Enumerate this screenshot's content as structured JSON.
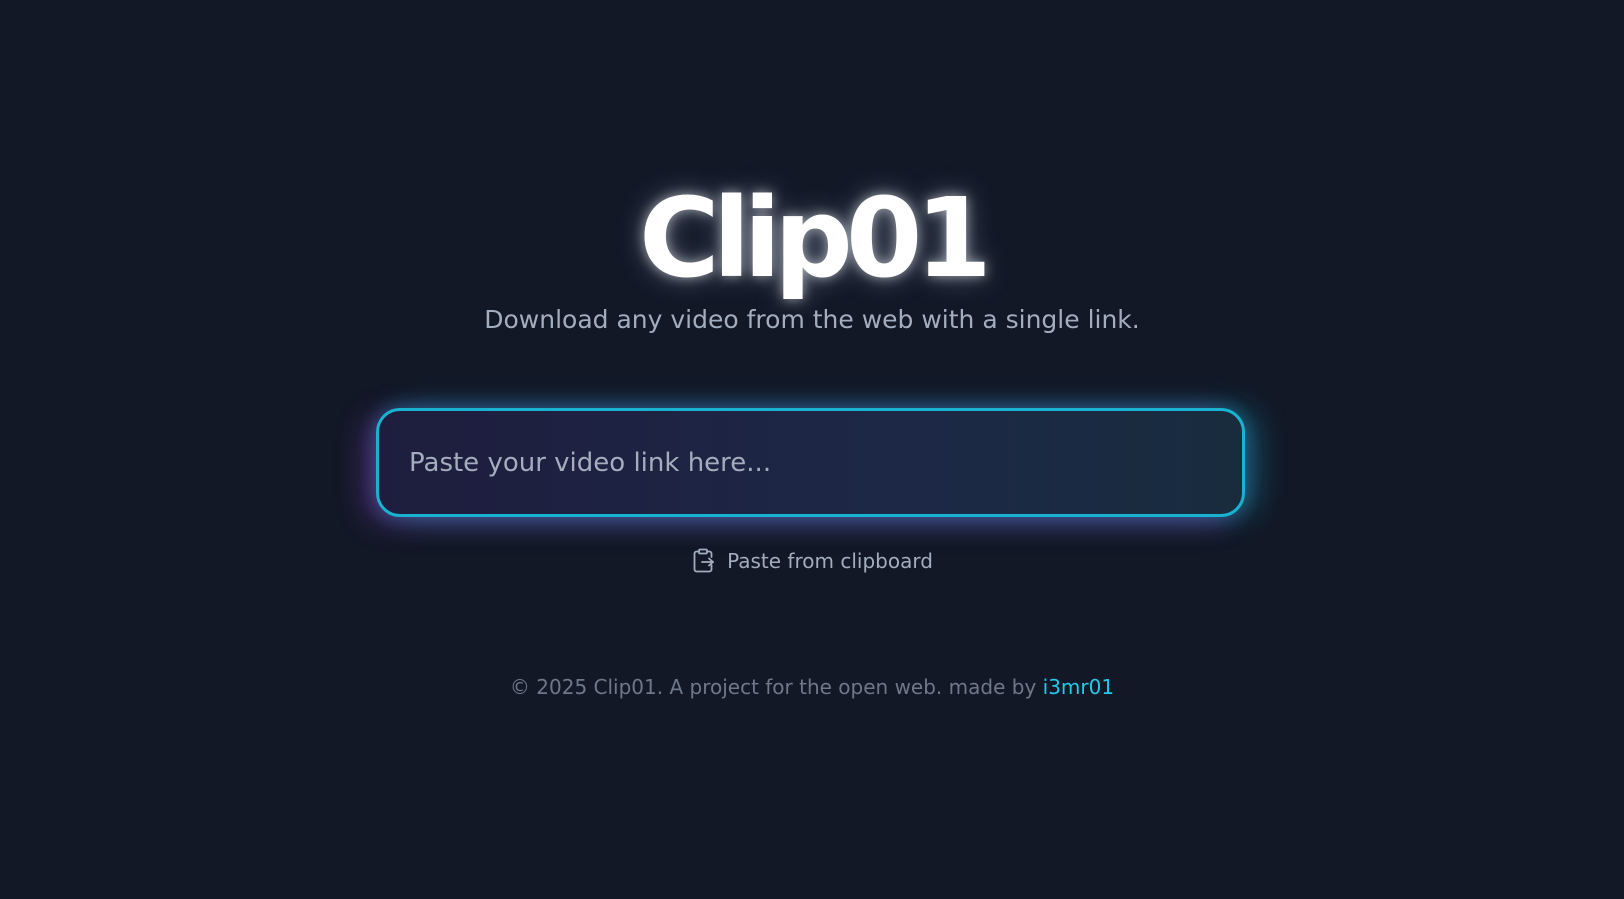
{
  "header": {
    "logo": "Clip01",
    "tagline": "Download any video from the web with a single link."
  },
  "input": {
    "placeholder": "Paste your video link here...",
    "value": ""
  },
  "paste_button": {
    "icon": "clipboard-paste-icon",
    "label": "Paste from clipboard"
  },
  "footer": {
    "text": "© 2025 Clip01. A project for the open web. made by",
    "author_link": "i3mr01"
  },
  "colors": {
    "background": "#121826",
    "accent": "#19b3d1",
    "accent_secondary": "#b046e6",
    "link": "#22c9ea",
    "muted_text": "#a3adbd"
  }
}
